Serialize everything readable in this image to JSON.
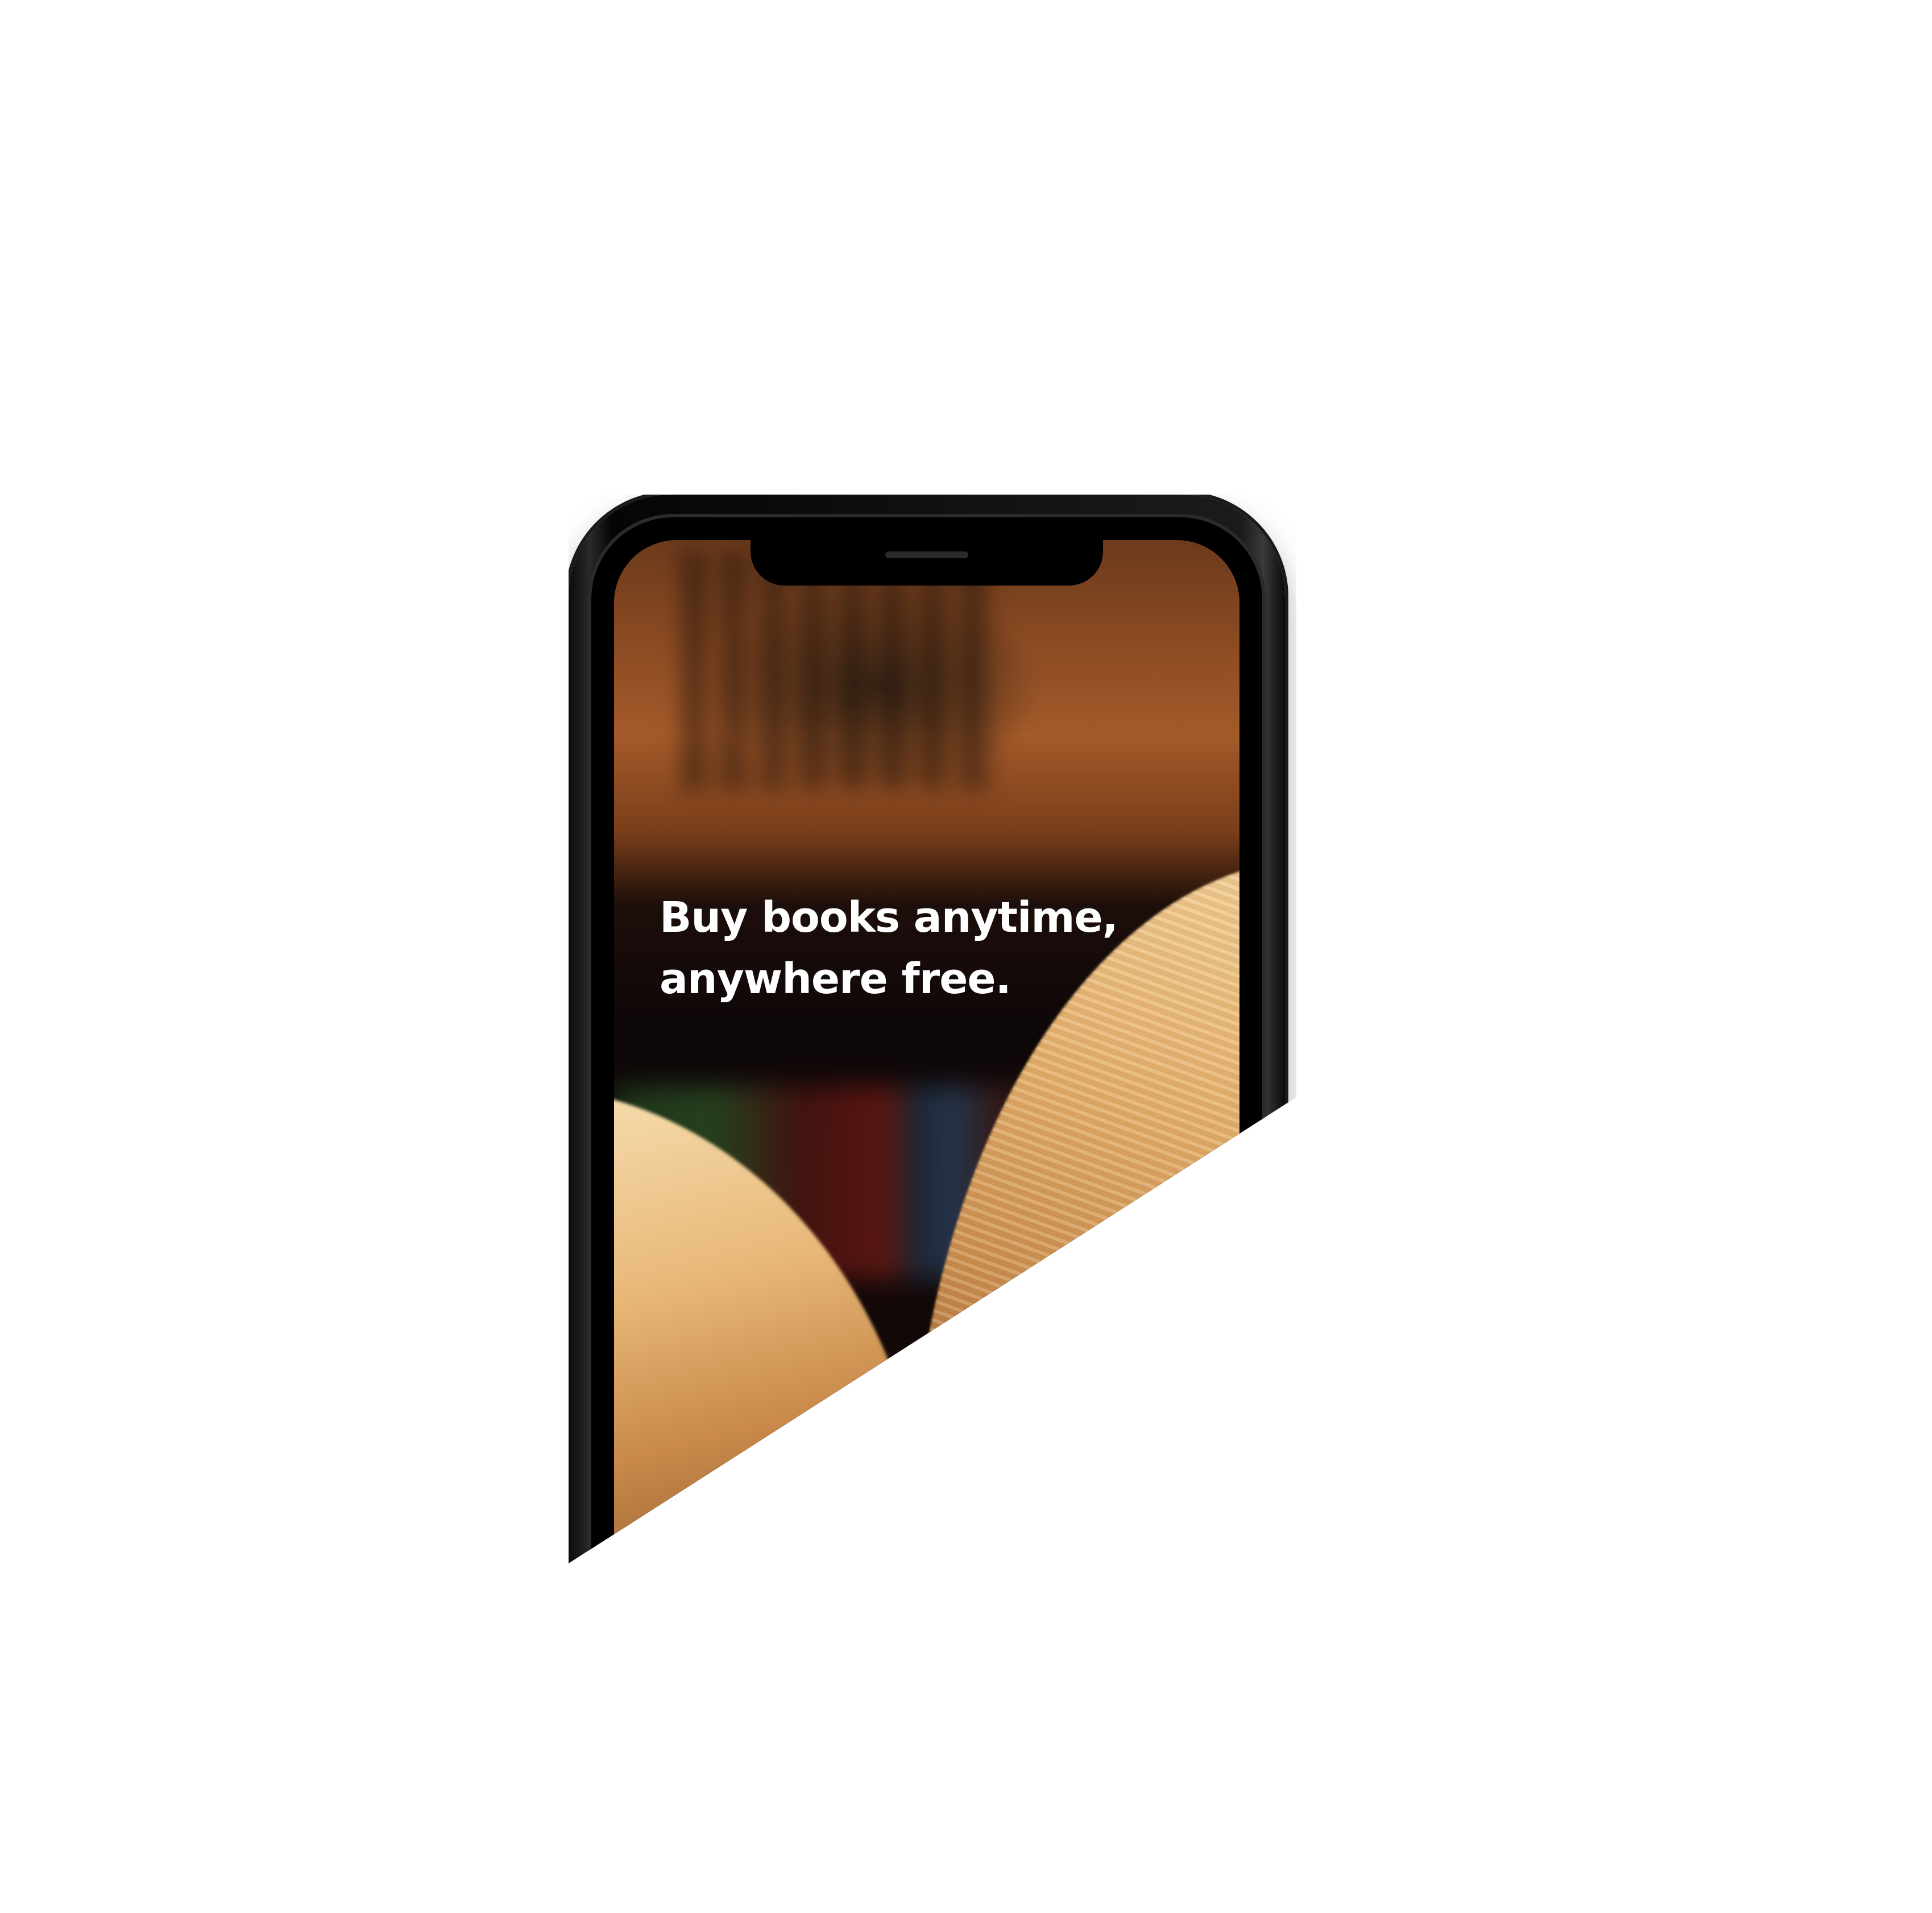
{
  "screen": {
    "headline_line1": "Buy books anytime,",
    "headline_line2": "anywhere free."
  },
  "colors": {
    "background": "#ffffff",
    "phone_frame": "#0b0b0b",
    "headline_text": "#ffffff"
  },
  "icons": {
    "speaker": "speaker-grille-icon"
  }
}
